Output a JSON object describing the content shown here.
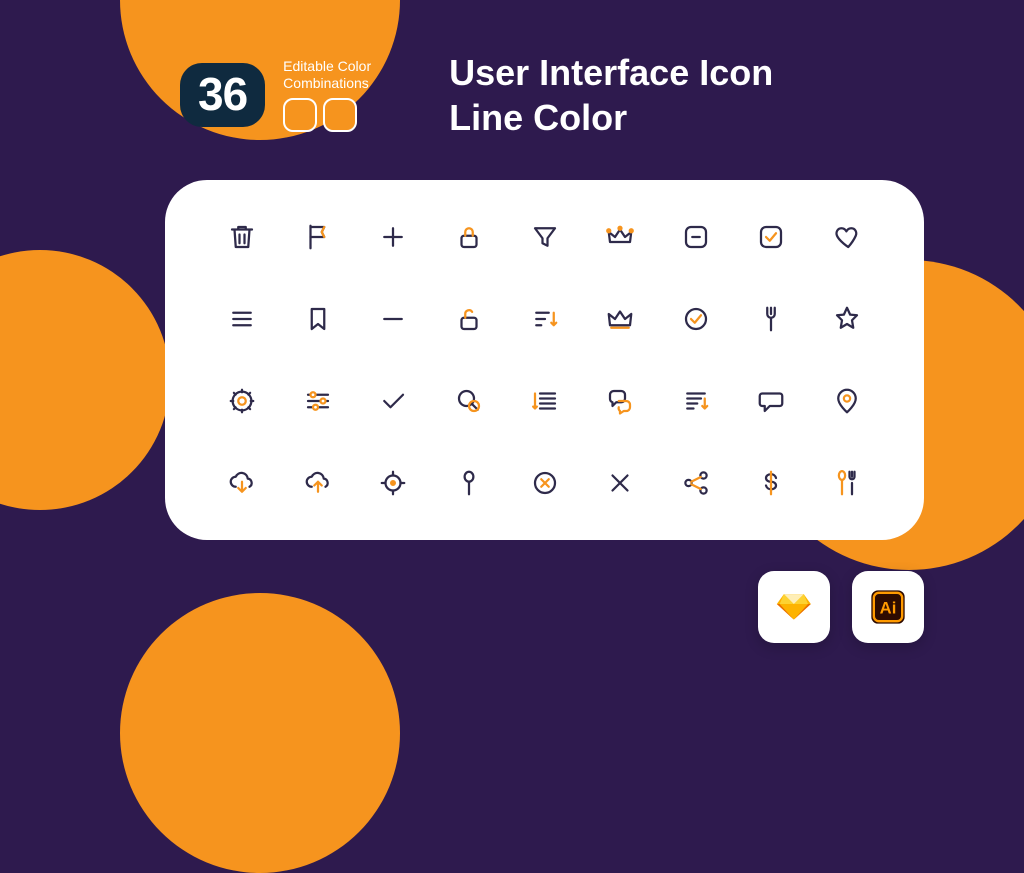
{
  "badge": {
    "count": "36"
  },
  "combos": {
    "line1": "Editable Color",
    "line2": "Combinations"
  },
  "title": {
    "line1": "User Interface Icon",
    "line2": "Line Color"
  },
  "apps": {
    "sketch": "Sketch",
    "ai": "Adobe Illustrator"
  },
  "colors": {
    "bg": "#2e1a4e",
    "accent": "#f6941e",
    "dark": "#0f2a3f",
    "icon_dark": "#2e2a4a"
  },
  "icons": [
    [
      "trash",
      "flag",
      "plus",
      "lock-closed",
      "funnel",
      "crown-filled-dots",
      "checkbox-minus",
      "checkbox-check",
      "heart"
    ],
    [
      "menu-lines",
      "bookmark",
      "minus",
      "lock-open",
      "sort-desc",
      "crown-outline",
      "check-circle",
      "fork",
      "star"
    ],
    [
      "gear",
      "sliders",
      "check",
      "chat-search",
      "list-lines",
      "chat-bubbles",
      "list-sort",
      "speech-bubble",
      "map-pin"
    ],
    [
      "cloud-download",
      "cloud-upload",
      "target",
      "spoon",
      "x-circle",
      "x",
      "share-nodes",
      "dollar",
      "spoon-fork"
    ]
  ]
}
